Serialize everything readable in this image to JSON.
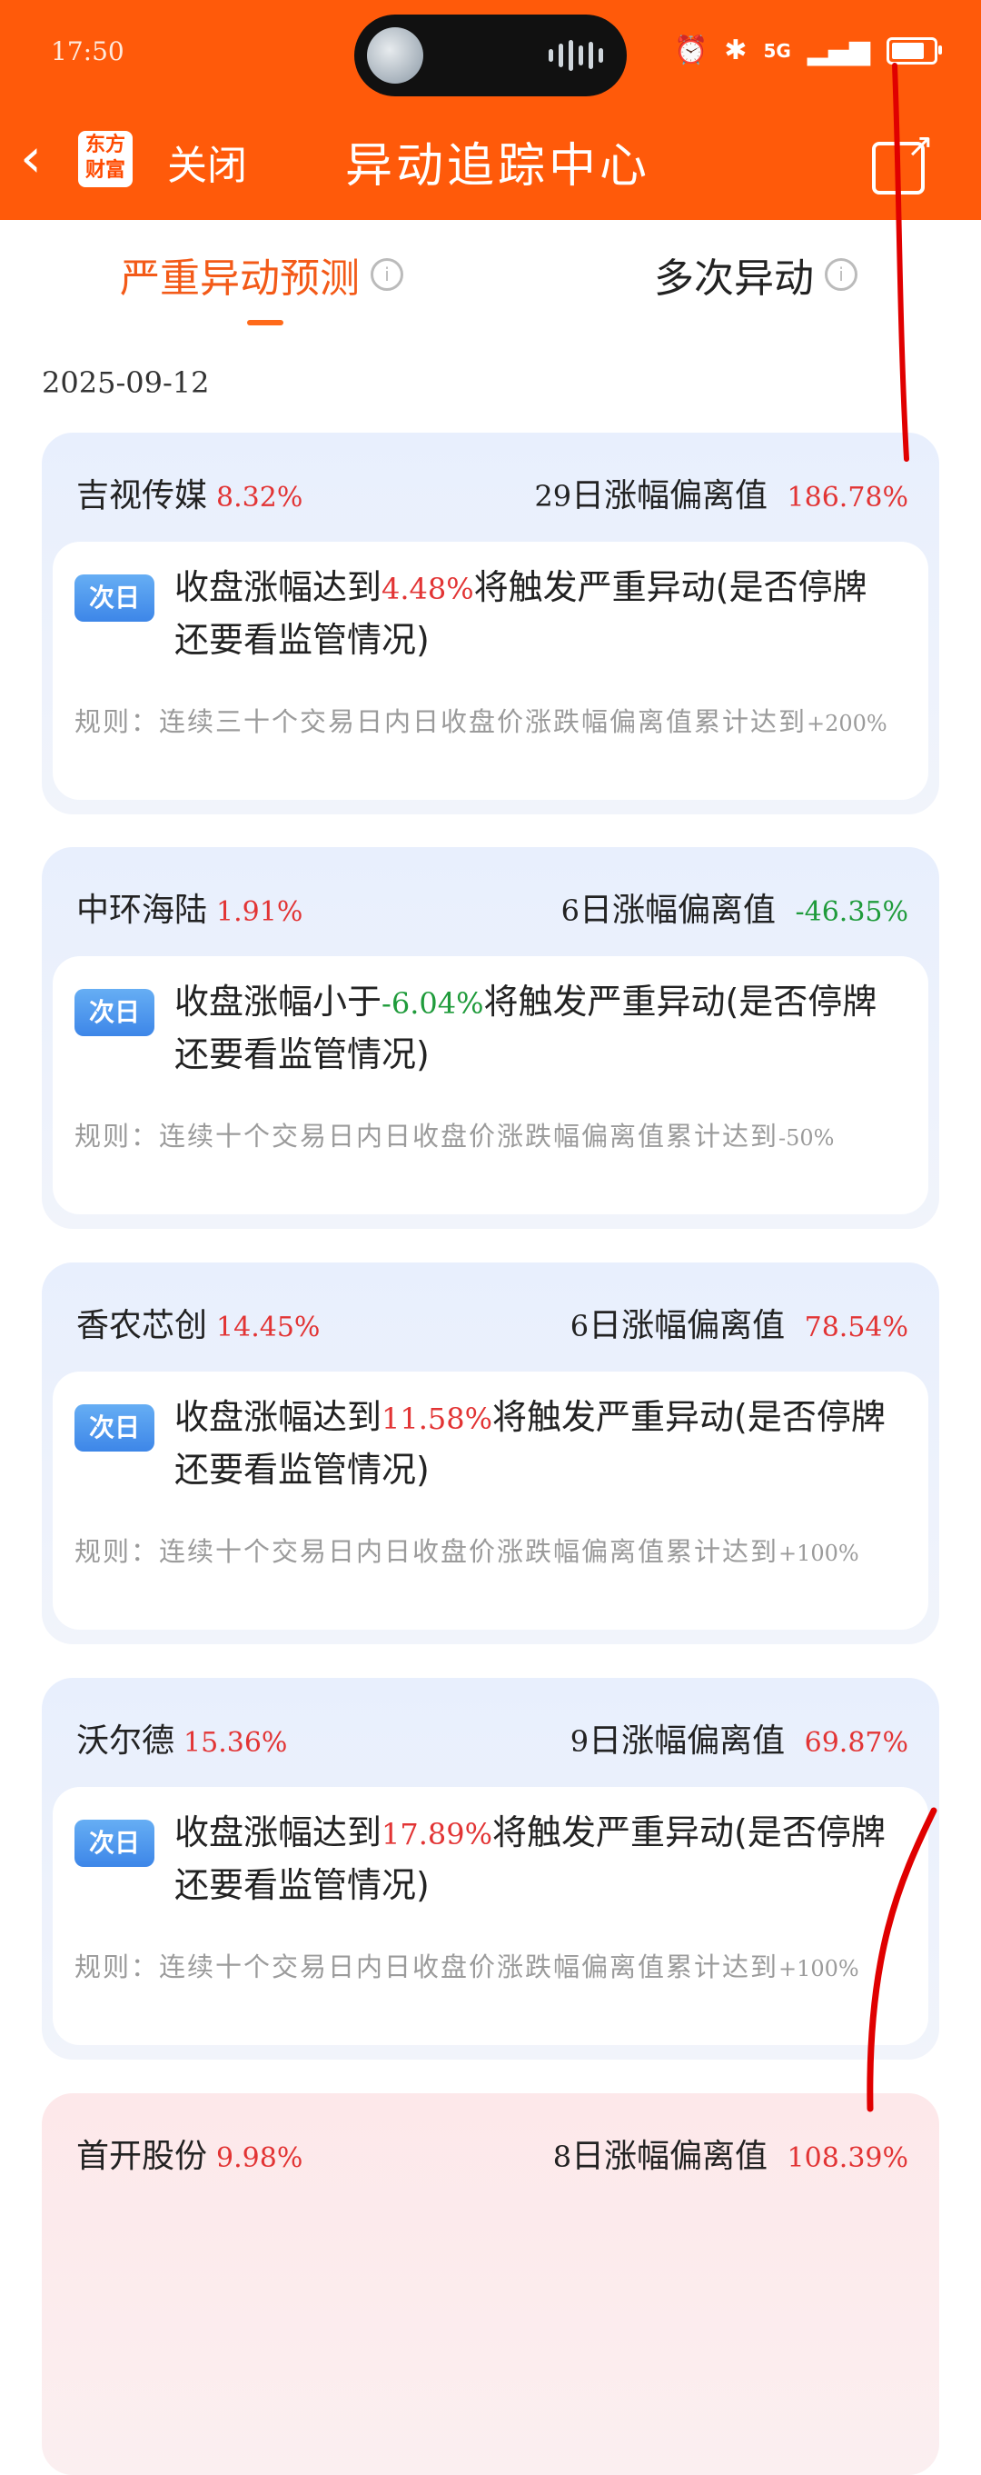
{
  "status_bar": {
    "time": "17:50",
    "network": "5G",
    "battery_level": 0.8
  },
  "nav": {
    "back_icon": "chevron-left-icon",
    "logo_line1": "东方",
    "logo_line2": "财富",
    "close_label": "关闭",
    "title": "异动追踪中心",
    "share_icon": "share-icon"
  },
  "tabs": [
    {
      "label": "严重异动预测",
      "active": true
    },
    {
      "label": "多次异动",
      "active": false
    }
  ],
  "date": "2025-09-12",
  "badge_label": "次日",
  "cards": [
    {
      "name": "吉视传媒",
      "pct": "8.32%",
      "days": "29",
      "metric_label": "日涨幅偏离值",
      "metric_value": "186.78%",
      "metric_color": "red",
      "msg_pre": "收盘涨幅达到",
      "msg_num": "4.48%",
      "msg_post": "将触发严重异动(是否停牌还要看监管情况)",
      "rule": "规则：连续三十个交易日内日收盘价涨跌幅偏离值累计达到",
      "rule_tail": "+200%"
    },
    {
      "name": "中环海陆",
      "pct": "1.91%",
      "days": "6",
      "metric_label": "日涨幅偏离值",
      "metric_value": "-46.35%",
      "metric_color": "green",
      "msg_pre": "收盘涨幅小于",
      "msg_num": "-6.04%",
      "msg_post": "将触发严重异动(是否停牌还要看监管情况)",
      "rule": "规则：连续十个交易日内日收盘价涨跌幅偏离值累计达到",
      "rule_tail": "-50%"
    },
    {
      "name": "香农芯创",
      "pct": "14.45%",
      "days": "6",
      "metric_label": "日涨幅偏离值",
      "metric_value": "78.54%",
      "metric_color": "red",
      "msg_pre": "收盘涨幅达到",
      "msg_num": "11.58%",
      "msg_post": "将触发严重异动(是否停牌还要看监管情况)",
      "rule": "规则：连续十个交易日内日收盘价涨跌幅偏离值累计达到",
      "rule_tail": "+100%"
    },
    {
      "name": "沃尔德",
      "pct": "15.36%",
      "days": "9",
      "metric_label": "日涨幅偏离值",
      "metric_value": "69.87%",
      "metric_color": "red",
      "msg_pre": "收盘涨幅达到",
      "msg_num": "17.89%",
      "msg_post": "将触发严重异动(是否停牌还要看监管情况)",
      "rule": "规则：连续十个交易日内日收盘价涨跌幅偏离值累计达到",
      "rule_tail": "+100%"
    },
    {
      "name": "首开股份",
      "pct": "9.98%",
      "days": "8",
      "metric_label": "日涨幅偏离值",
      "metric_value": "108.39%",
      "metric_color": "red"
    }
  ]
}
